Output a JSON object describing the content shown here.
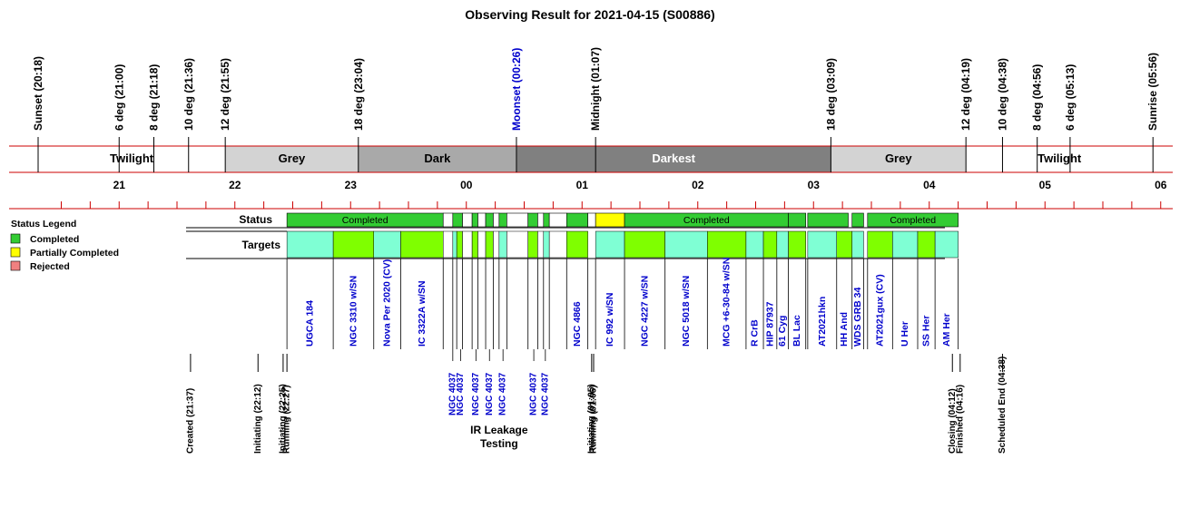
{
  "chart_data": {
    "type": "timeline",
    "title": "Observing Result for 2021-04-15 (S00886)",
    "axis": {
      "unit": "hours (local time)",
      "range": [
        20.3,
        30.15
      ],
      "tick_labels": [
        {
          "value": 21,
          "label": "21"
        },
        {
          "value": 22,
          "label": "22"
        },
        {
          "value": 23,
          "label": "23"
        },
        {
          "value": 24,
          "label": "00"
        },
        {
          "value": 25,
          "label": "01"
        },
        {
          "value": 26,
          "label": "02"
        },
        {
          "value": 27,
          "label": "03"
        },
        {
          "value": 28,
          "label": "04"
        },
        {
          "value": 29,
          "label": "05"
        },
        {
          "value": 30,
          "label": "06"
        }
      ]
    },
    "colors": {
      "grid_red": "#cc0000",
      "twilight": "#ffffff",
      "grey": "#d3d3d3",
      "dark": "#a9a9a9",
      "darkest": "#808080",
      "completed": "#33cc33",
      "partial": "#ffff00",
      "rejected": "#f08080",
      "target_light": "#7fffd4",
      "target_green": "#7fff00",
      "blue_text": "#0000cc"
    },
    "sky_events": [
      {
        "time": 20.3,
        "label": "Sunset (20:18)",
        "color": "black"
      },
      {
        "time": 21.0,
        "label": "6 deg (21:00)",
        "color": "black"
      },
      {
        "time": 21.3,
        "label": "8 deg (21:18)",
        "color": "black"
      },
      {
        "time": 21.6,
        "label": "10 deg (21:36)",
        "color": "black"
      },
      {
        "time": 21.917,
        "label": "12 deg (21:55)",
        "color": "black"
      },
      {
        "time": 23.067,
        "label": "18 deg (23:04)",
        "color": "black"
      },
      {
        "time": 24.433,
        "label": "Moonset (00:26)",
        "color": "blue"
      },
      {
        "time": 25.117,
        "label": "Midnight (01:07)",
        "color": "black"
      },
      {
        "time": 27.15,
        "label": "18 deg (03:09)",
        "color": "black"
      },
      {
        "time": 28.317,
        "label": "12 deg (04:19)",
        "color": "black"
      },
      {
        "time": 28.633,
        "label": "10 deg (04:38)",
        "color": "black"
      },
      {
        "time": 28.933,
        "label": "8 deg (04:56)",
        "color": "black"
      },
      {
        "time": 29.217,
        "label": "6 deg (05:13)",
        "color": "black"
      },
      {
        "time": 29.933,
        "label": "Sunrise (05:56)",
        "color": "black"
      }
    ],
    "sky_bands": [
      {
        "start": 20.3,
        "end": 21.917,
        "label": "Twilight",
        "fill": "twilight"
      },
      {
        "start": 21.917,
        "end": 23.067,
        "label": "Grey",
        "fill": "grey"
      },
      {
        "start": 23.067,
        "end": 24.433,
        "label": "Dark",
        "fill": "dark"
      },
      {
        "start": 24.433,
        "end": 27.15,
        "label": "Darkest",
        "fill": "darkest"
      },
      {
        "start": 27.15,
        "end": 28.317,
        "label": "Grey",
        "fill": "grey"
      },
      {
        "start": 28.317,
        "end": 29.933,
        "label": "Twilight",
        "fill": "twilight"
      }
    ],
    "row_labels": {
      "status": "Status",
      "targets": "Targets"
    },
    "legend": {
      "title": "Status Legend",
      "items": [
        {
          "label": "Completed",
          "color": "#33cc33"
        },
        {
          "label": "Partially Completed",
          "color": "#ffff00"
        },
        {
          "label": "Rejected",
          "color": "#f08080"
        }
      ]
    },
    "status_blocks": [
      {
        "start": 22.45,
        "end": 23.8,
        "state": "completed",
        "label": "Completed"
      },
      {
        "start": 23.8,
        "end": 23.883,
        "state": "none",
        "label": ""
      },
      {
        "start": 23.883,
        "end": 23.967,
        "state": "completed",
        "label": ""
      },
      {
        "start": 23.967,
        "end": 24.05,
        "state": "none",
        "label": ""
      },
      {
        "start": 24.05,
        "end": 24.1,
        "state": "completed",
        "label": ""
      },
      {
        "start": 24.1,
        "end": 24.167,
        "state": "none",
        "label": ""
      },
      {
        "start": 24.167,
        "end": 24.233,
        "state": "completed",
        "label": ""
      },
      {
        "start": 24.233,
        "end": 24.283,
        "state": "none",
        "label": ""
      },
      {
        "start": 24.283,
        "end": 24.35,
        "state": "completed",
        "label": ""
      },
      {
        "start": 24.35,
        "end": 24.533,
        "state": "none",
        "label": ""
      },
      {
        "start": 24.533,
        "end": 24.617,
        "state": "completed",
        "label": ""
      },
      {
        "start": 24.617,
        "end": 24.667,
        "state": "none",
        "label": ""
      },
      {
        "start": 24.667,
        "end": 24.717,
        "state": "completed",
        "label": ""
      },
      {
        "start": 24.717,
        "end": 24.867,
        "state": "none",
        "label": ""
      },
      {
        "start": 24.867,
        "end": 25.05,
        "state": "completed",
        "label": ""
      },
      {
        "start": 25.05,
        "end": 25.117,
        "state": "none",
        "label": ""
      },
      {
        "start": 25.117,
        "end": 25.367,
        "state": "partial",
        "label": ""
      },
      {
        "start": 25.367,
        "end": 26.783,
        "state": "completed",
        "label": "Completed"
      },
      {
        "start": 26.783,
        "end": 26.933,
        "state": "completed",
        "label": ""
      },
      {
        "start": 26.95,
        "end": 27.3,
        "state": "completed",
        "label": ""
      },
      {
        "start": 27.333,
        "end": 27.433,
        "state": "completed",
        "label": ""
      },
      {
        "start": 27.467,
        "end": 28.25,
        "state": "completed",
        "label": "Completed"
      }
    ],
    "targets": [
      {
        "start": 22.45,
        "end": 22.85,
        "color": "target_light",
        "label": "UGCA 184"
      },
      {
        "start": 22.85,
        "end": 23.2,
        "color": "target_green",
        "label": "NGC 3310 w/SN"
      },
      {
        "start": 23.2,
        "end": 23.433,
        "color": "target_light",
        "label": "Nova Per 2020 (CV)"
      },
      {
        "start": 23.433,
        "end": 23.8,
        "color": "target_green",
        "label": "IC 3322A w/SN"
      },
      {
        "start": 23.8,
        "end": 23.883,
        "color": "white",
        "label": ""
      },
      {
        "start": 23.883,
        "end": 23.917,
        "color": "target_light",
        "label": ""
      },
      {
        "start": 23.917,
        "end": 23.967,
        "color": "target_green",
        "label": ""
      },
      {
        "start": 23.967,
        "end": 24.05,
        "color": "white",
        "label": ""
      },
      {
        "start": 24.05,
        "end": 24.1,
        "color": "target_green",
        "label": ""
      },
      {
        "start": 24.1,
        "end": 24.167,
        "color": "white",
        "label": ""
      },
      {
        "start": 24.167,
        "end": 24.233,
        "color": "target_green",
        "label": ""
      },
      {
        "start": 24.233,
        "end": 24.283,
        "color": "white",
        "label": ""
      },
      {
        "start": 24.283,
        "end": 24.35,
        "color": "target_light",
        "label": ""
      },
      {
        "start": 24.35,
        "end": 24.533,
        "color": "white",
        "label": ""
      },
      {
        "start": 24.533,
        "end": 24.617,
        "color": "target_green",
        "label": ""
      },
      {
        "start": 24.617,
        "end": 24.667,
        "color": "white",
        "label": ""
      },
      {
        "start": 24.667,
        "end": 24.717,
        "color": "target_light",
        "label": ""
      },
      {
        "start": 24.717,
        "end": 24.867,
        "color": "white",
        "label": ""
      },
      {
        "start": 24.867,
        "end": 25.05,
        "color": "target_green",
        "label": "NGC 4866"
      },
      {
        "start": 25.117,
        "end": 25.367,
        "color": "target_light",
        "label": "IC 992 w/SN"
      },
      {
        "start": 25.367,
        "end": 25.717,
        "color": "target_green",
        "label": "NGC 4227 w/SN"
      },
      {
        "start": 25.717,
        "end": 26.083,
        "color": "target_light",
        "label": "NGC 5018 w/SN"
      },
      {
        "start": 26.083,
        "end": 26.417,
        "color": "target_green",
        "label": "MCG +6-30-84 w/SN"
      },
      {
        "start": 26.417,
        "end": 26.567,
        "color": "target_light",
        "label": "R CrB"
      },
      {
        "start": 26.567,
        "end": 26.683,
        "color": "target_green",
        "label": "HIP 87937"
      },
      {
        "start": 26.683,
        "end": 26.783,
        "color": "target_light",
        "label": "61 Cyg"
      },
      {
        "start": 26.783,
        "end": 26.933,
        "color": "target_green",
        "label": "BL Lac"
      },
      {
        "start": 26.95,
        "end": 27.2,
        "color": "target_light",
        "label": "AT2021hkn"
      },
      {
        "start": 27.2,
        "end": 27.333,
        "color": "target_green",
        "label": "HH And"
      },
      {
        "start": 27.333,
        "end": 27.433,
        "color": "target_light",
        "label": "WDS GRB 34"
      },
      {
        "start": 27.467,
        "end": 27.683,
        "color": "target_green",
        "label": "AT2021gux (CV)"
      },
      {
        "start": 27.683,
        "end": 27.9,
        "color": "target_light",
        "label": "U Her"
      },
      {
        "start": 27.9,
        "end": 28.05,
        "color": "target_green",
        "label": "SS Her"
      },
      {
        "start": 28.05,
        "end": 28.25,
        "color": "target_light",
        "label": "AM Her"
      }
    ],
    "mini_targets": [
      {
        "time": 23.883,
        "label": "NGC 4037"
      },
      {
        "time": 23.95,
        "label": "NGC 4037"
      },
      {
        "time": 24.083,
        "label": "NGC 4037"
      },
      {
        "time": 24.2,
        "label": "NGC 4037"
      },
      {
        "time": 24.317,
        "label": "NGC 4037"
      },
      {
        "time": 24.583,
        "label": "NGC 4037"
      },
      {
        "time": 24.683,
        "label": "NGC 4037"
      }
    ],
    "group_note": {
      "center": 24.283,
      "lines": [
        "IR Leakage",
        "Testing"
      ]
    },
    "events": [
      {
        "time": 21.617,
        "label": "Created (21:37)"
      },
      {
        "time": 22.2,
        "label": "Initiating (22:12)"
      },
      {
        "time": 22.417,
        "label": "Initiating (22:25)"
      },
      {
        "time": 22.45,
        "label": "Running (22:27)"
      },
      {
        "time": 25.083,
        "label": "Initiating (01:05)"
      },
      {
        "time": 25.1,
        "label": "Running (01:06)"
      },
      {
        "time": 28.2,
        "label": "Closing (04:12)"
      },
      {
        "time": 28.267,
        "label": "Finished (04:16)"
      },
      {
        "time": 28.633,
        "label": "Scheduled End (04:38)"
      }
    ]
  }
}
